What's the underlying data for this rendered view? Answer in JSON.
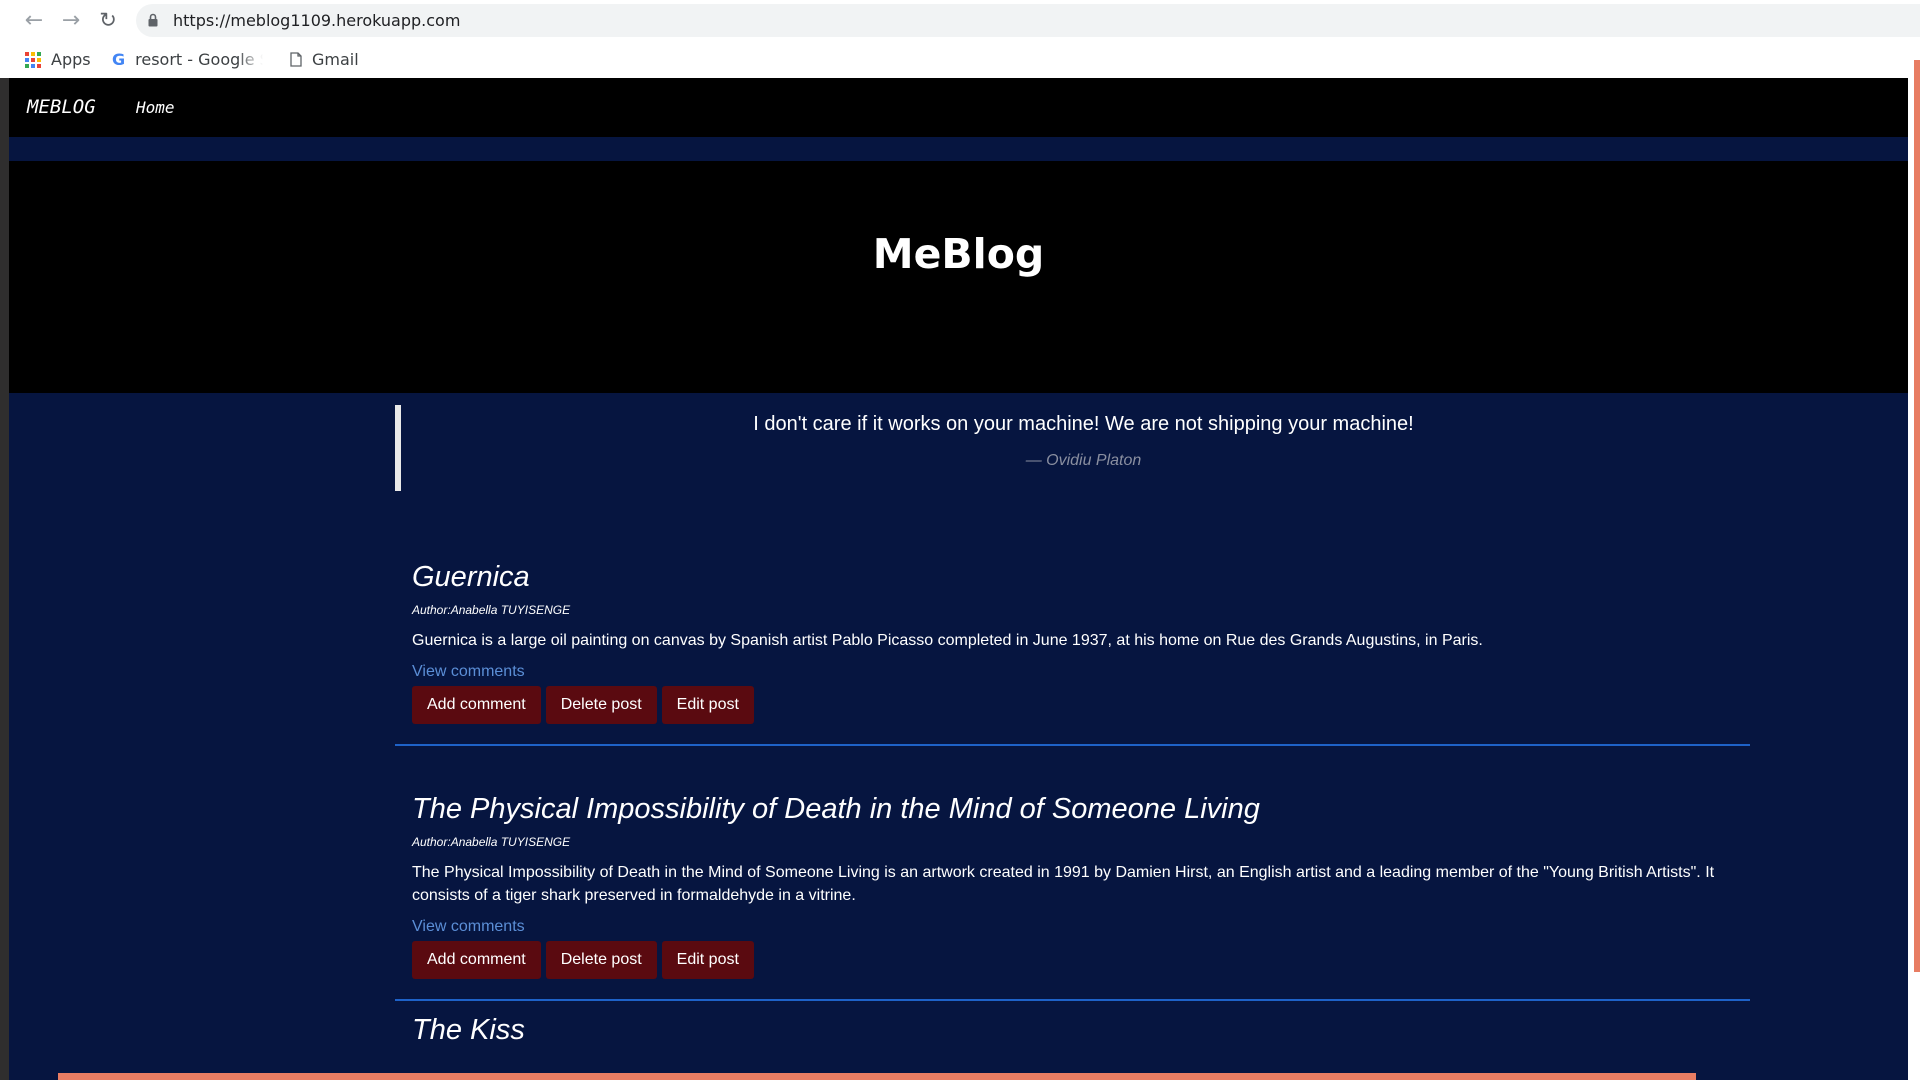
{
  "browser": {
    "url": "https://meblog1109.herokuapp.com",
    "bookmarks": [
      {
        "label": "Apps",
        "icon": "apps-grid-icon"
      },
      {
        "label": "resort - Google S",
        "icon": "google-icon"
      },
      {
        "label": "Gmail",
        "icon": "page-icon"
      }
    ]
  },
  "site": {
    "brand": "MEBLOG",
    "nav_home": "Home",
    "hero_title": "MeBlog",
    "quote": {
      "text": "I don't care if it works on your machine! We are not shipping your machine!",
      "author": "— Ovidiu Platon"
    }
  },
  "posts": [
    {
      "title": "Guernica",
      "author": "Author:Anabella TUYISENGE",
      "body": "Guernica is a large oil painting on canvas by Spanish artist Pablo Picasso completed in June 1937, at his home on Rue des Grands Augustins, in Paris.",
      "view_comments": "View comments",
      "add_comment": "Add comment",
      "delete_post": "Delete post",
      "edit_post": "Edit post"
    },
    {
      "title": "The Physical Impossibility of Death in the Mind of Someone Living",
      "author": "Author:Anabella TUYISENGE",
      "body": "The Physical Impossibility of Death in the Mind of Someone Living is an artwork created in 1991 by Damien Hirst, an English artist and a leading member of the \"Young British Artists\". It consists of a tiger shark preserved in formaldehyde in a vitrine.",
      "view_comments": "View comments",
      "add_comment": "Add comment",
      "delete_post": "Delete post",
      "edit_post": "Edit post"
    },
    {
      "title": "The Kiss"
    }
  ],
  "colors": {
    "page_background": "#061540",
    "navbar": "#000000",
    "button": "#5a0a10",
    "link": "#5b8ed6",
    "divider": "#1e62c8",
    "scroll_indicator": "#e87d63"
  }
}
